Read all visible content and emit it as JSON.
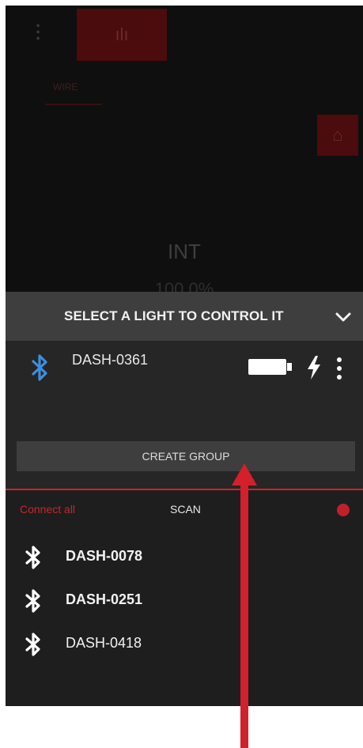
{
  "background": {
    "tab_label": "WIRE",
    "mode_label": "INT",
    "level_label": "100.0%"
  },
  "sheet": {
    "title": "SELECT A LIGHT TO CONTROL IT"
  },
  "connected_device": {
    "name": "DASH-0361",
    "icon_color": "#3d8fe0"
  },
  "create_group_label": "CREATE GROUP",
  "scan_bar": {
    "connect_all_label": "Connect all",
    "scan_label": "SCAN",
    "accent_color": "#d3202a"
  },
  "scanned_devices": [
    {
      "name": "DASH-0078"
    },
    {
      "name": "DASH-0251"
    },
    {
      "name": "DASH-0418"
    }
  ],
  "annotation": {
    "arrow_color": "#d3202a"
  }
}
